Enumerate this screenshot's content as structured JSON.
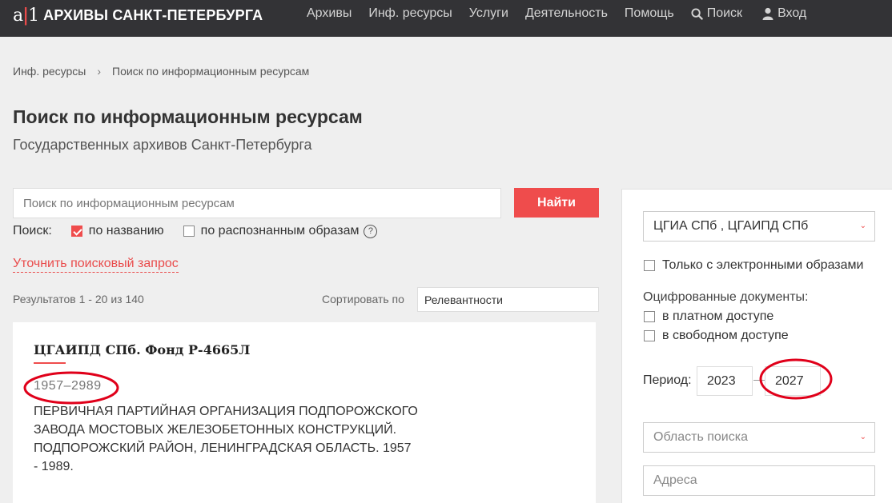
{
  "header": {
    "logo_mark": "a",
    "logo_pipe": "|",
    "logo_mark_end": "1",
    "site_title": "АРХИВЫ САНКТ-ПЕТЕРБУРГА",
    "nav": [
      "Архивы",
      "Инф. ресурсы",
      "Услуги",
      "Деятельность",
      "Помощь"
    ],
    "search_label": "Поиск",
    "login_label": "Вход"
  },
  "breadcrumb": {
    "parent": "Инф. ресурсы",
    "separator": "›",
    "current": "Поиск по информационным ресурсам"
  },
  "page": {
    "title": "Поиск по информационным ресурсам",
    "subtitle": "Государственных архивов Санкт-Петербурга"
  },
  "search": {
    "placeholder": "Поиск по информационным ресурсам",
    "button": "Найти",
    "mode_label": "Поиск:",
    "by_name": "по названию",
    "by_images": "по распознанным образам",
    "help": "?",
    "refine": "Уточнить поисковый запрос"
  },
  "results": {
    "count": "Результатов 1 - 20 из 140",
    "sort_label": "Сортировать по",
    "sort_value": "Релевантности",
    "items": [
      {
        "title": "ЦГАИПД СПб. Фонд Р-4665Л",
        "dates": "1957–2989",
        "description": "ПЕРВИЧНАЯ ПАРТИЙНАЯ ОРГАНИЗАЦИЯ ПОДПОРОЖСКОГО ЗАВОДА МОСТОВЫХ ЖЕЛЕЗОБЕТОННЫХ КОНСТРУКЦИЙ. ПОДПОРОЖСКИЙ РАЙОН, ЛЕНИНГРАДСКАЯ ОБЛАСТЬ. 1957 - 1989."
      }
    ]
  },
  "filters": {
    "archives": "ЦГИА СПб , ЦГАИПД СПб",
    "only_electronic": "Только с электронными образами",
    "digitized_label": "Оцифрованные документы:",
    "paid": "в платном доступе",
    "free": "в свободном доступе",
    "period_label": "Период:",
    "period_from": "2023",
    "period_to": "2027",
    "area_placeholder": "Область поиска",
    "address_placeholder": "Адреса"
  },
  "colors": {
    "accent": "#ef4c4c",
    "topbar": "#333336",
    "annotation": "#e0001a"
  }
}
